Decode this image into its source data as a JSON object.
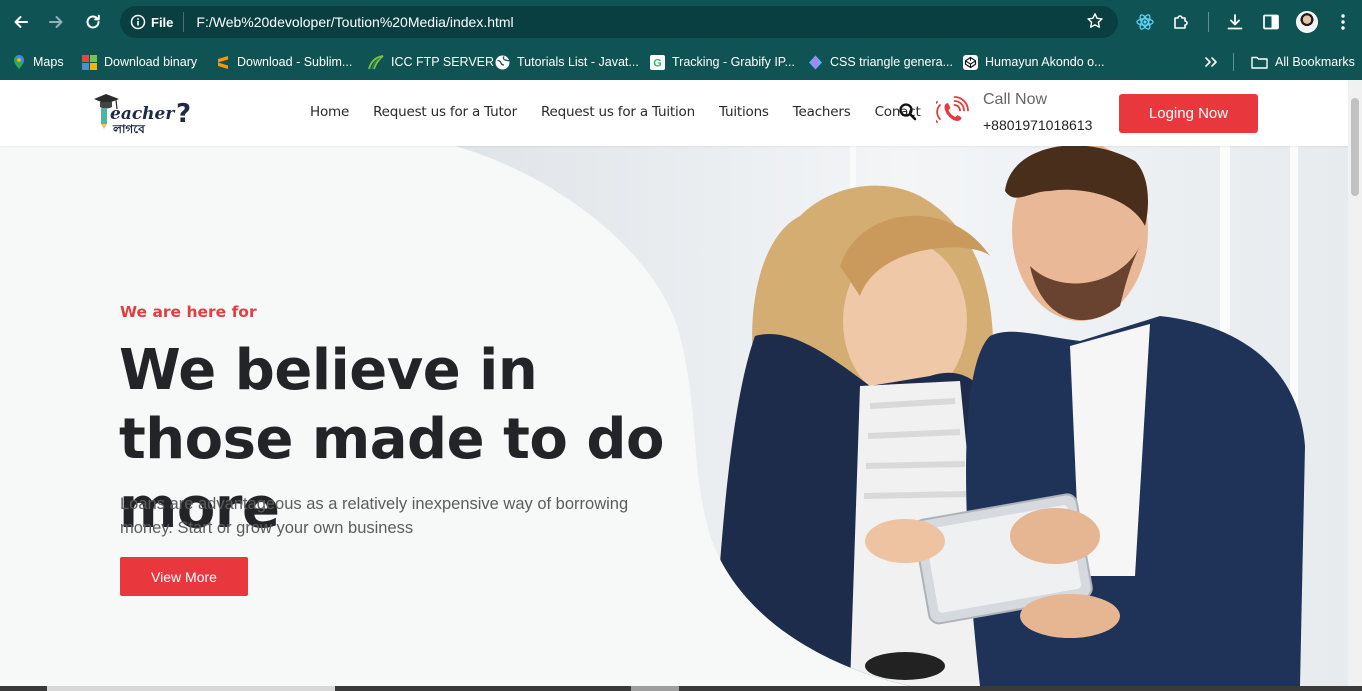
{
  "browser": {
    "info_label": "File",
    "url": "F:/Web%20devoloper/Toution%20Media/index.html",
    "bookmarks": [
      {
        "label": "Maps",
        "icon": "maps-icon",
        "color": "#34a853"
      },
      {
        "label": "Download binary",
        "icon": "grid-icon",
        "color": "#e8453c"
      },
      {
        "label": "Download - Sublim...",
        "icon": "sublime-icon",
        "color": "#ff9800"
      },
      {
        "label": "ICC FTP SERVER",
        "icon": "leaf-icon",
        "color": "#7cc142"
      },
      {
        "label": "Tutorials List - Javat...",
        "icon": "globe-icon",
        "color": "#ffffff"
      },
      {
        "label": "Tracking - Grabify IP...",
        "icon": "g-icon",
        "color": "#2bb673"
      },
      {
        "label": "CSS triangle genera...",
        "icon": "gem-icon",
        "color": "#5ab0f5"
      },
      {
        "label": "Humayun Akondo o...",
        "icon": "codepen-icon",
        "color": "#ffffff"
      }
    ],
    "all_bookmarks_label": "All Bookmarks"
  },
  "site": {
    "logo_text_top": "Teacher",
    "logo_text_bottom": "লাগবে?",
    "menu": [
      "Home",
      "Request us for a Tutor",
      "Request us for a Tuition",
      "Tuitions",
      "Teachers",
      "Conact"
    ],
    "call_label": "Call Now",
    "call_number": "+8801971018613",
    "login_label": "Loging Now",
    "accent_color": "#e8383d"
  },
  "hero": {
    "eyebrow": "We are here for",
    "headline": "We believe in those made to do more",
    "subtext": "Loans are advantageous as a relatively inexpensive way of borrowing money. Start or grow your own business",
    "cta_label": "View More"
  }
}
